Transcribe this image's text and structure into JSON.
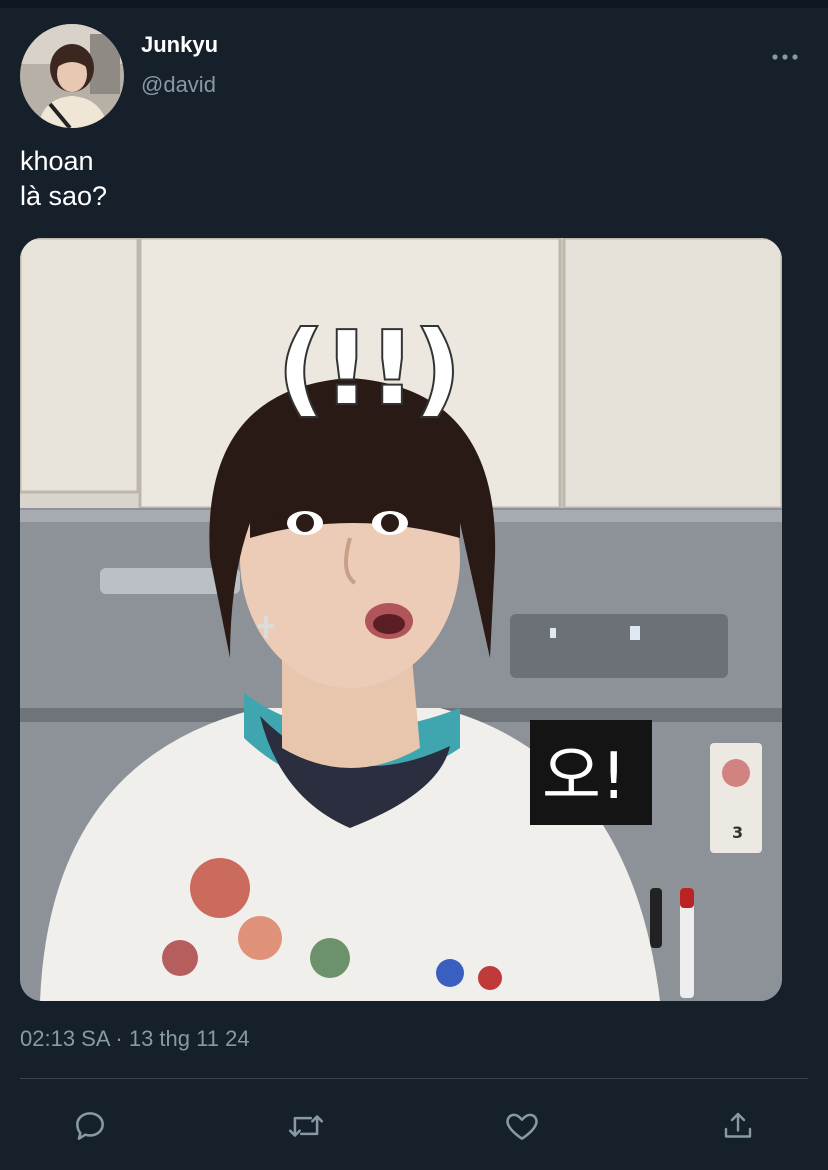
{
  "author": {
    "display_name": "Junkyu",
    "handle": "@david"
  },
  "tweet": {
    "line1": "khoan",
    "line2": "là sao?",
    "timestamp": "02:13 SA · 13 thg 11 24"
  },
  "media": {
    "sticker_top": "(!!)",
    "caption_label": "오!",
    "fridge_sticker_number": "3"
  },
  "actions": [
    "reply-icon",
    "retweet-icon",
    "like-icon",
    "share-icon"
  ],
  "colors": {
    "background": "#15202b",
    "secondary_text": "#8899a6",
    "divider": "#38444d"
  }
}
